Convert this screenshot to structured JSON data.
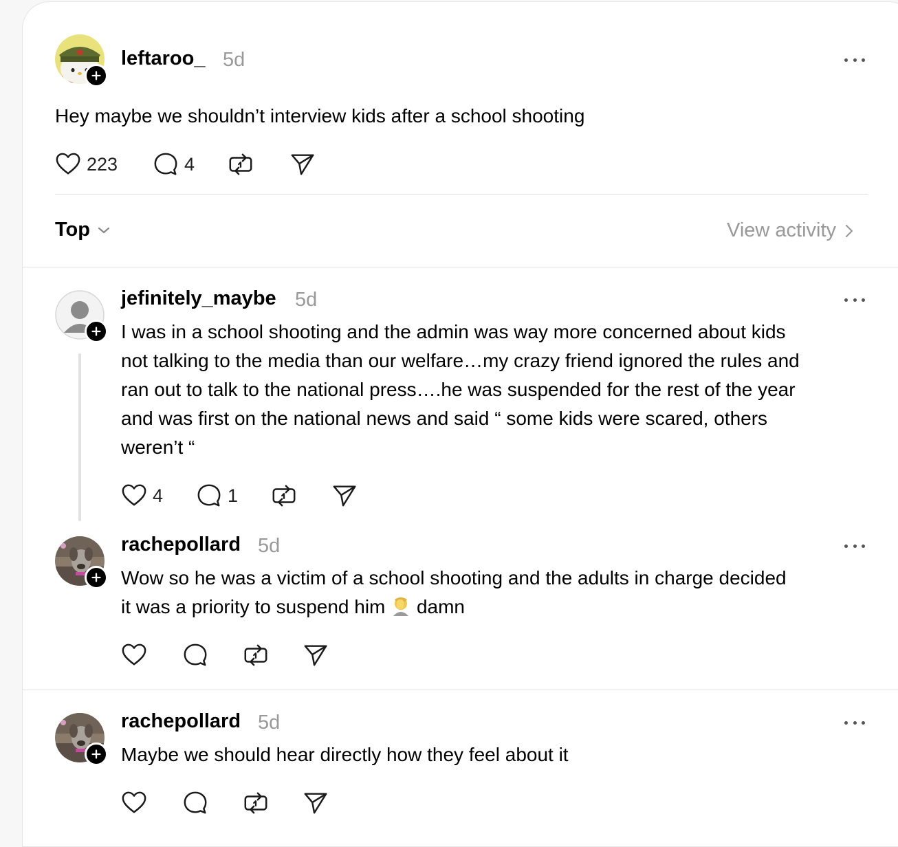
{
  "post": {
    "username": "leftaroo_",
    "time": "5d",
    "text": "Hey maybe we shouldn’t interview kids after a school shooting",
    "likes": "223",
    "replies": "4"
  },
  "sort": {
    "label": "Top",
    "view_activity": "View activity"
  },
  "comments": [
    {
      "username": "jefinitely_maybe",
      "time": "5d",
      "text_lines": [
        "I was in a school shooting and the admin was way more concerned about kids",
        "not talking to the media than our welfare…my crazy friend ignored the rules and",
        "ran out to talk to the national press….he was suspended for the rest of the year",
        "and was first on the national news and said “ some kids were scared, others",
        "weren’t “"
      ],
      "likes": "4",
      "replies": "1"
    },
    {
      "username": "rachepollard",
      "time": "5d",
      "text_line1": "Wow so he was a victim of a school shooting and the adults in charge decided",
      "text_line2_before": "it was a priority to suspend him",
      "text_line2_emoji": "face-palm-emoji",
      "text_line2_after": "damn"
    },
    {
      "username": "rachepollard",
      "time": "5d",
      "text": "Maybe we should hear directly how they feel about it"
    }
  ],
  "icons": {
    "like": "heart-icon",
    "reply": "speech-bubble-icon",
    "repost": "repost-icon",
    "share": "send-icon",
    "more": "more-dots-icon",
    "follow": "plus-icon"
  }
}
